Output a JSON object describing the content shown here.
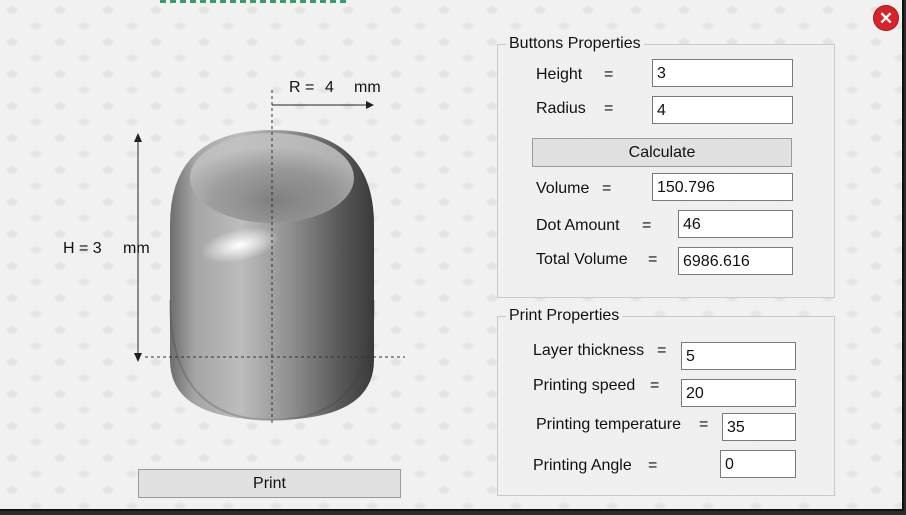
{
  "window": {
    "close_icon": "close-icon",
    "accent": "#d8232a"
  },
  "preview": {
    "radius_label": "R =",
    "radius_value": "4",
    "radius_unit": "mm",
    "height_label": "H = 3",
    "height_unit": "mm",
    "print_button": "Print"
  },
  "buttons_properties": {
    "title": "Buttons Properties",
    "height_label": "Height",
    "height_eq": "=",
    "height_value": "3",
    "radius_label": "Radius",
    "radius_eq": "=",
    "radius_value": "4",
    "calculate_button": "Calculate",
    "volume_label": "Volume",
    "volume_eq": "=",
    "volume_value": "150.796",
    "dot_amount_label": "Dot Amount",
    "dot_amount_eq": "=",
    "dot_amount_value": "46",
    "total_volume_label": "Total Volume",
    "total_volume_eq": "=",
    "total_volume_value": "6986.616"
  },
  "print_properties": {
    "title": "Print Properties",
    "layer_label": "Layer thickness",
    "layer_eq": "=",
    "layer_value": "5",
    "speed_label": "Printing speed",
    "speed_eq": "=",
    "speed_value": "20",
    "temp_label": "Printing temperature",
    "temp_eq": "=",
    "temp_value": "35",
    "angle_label": "Printing Angle",
    "angle_eq": "=",
    "angle_value": "0"
  }
}
